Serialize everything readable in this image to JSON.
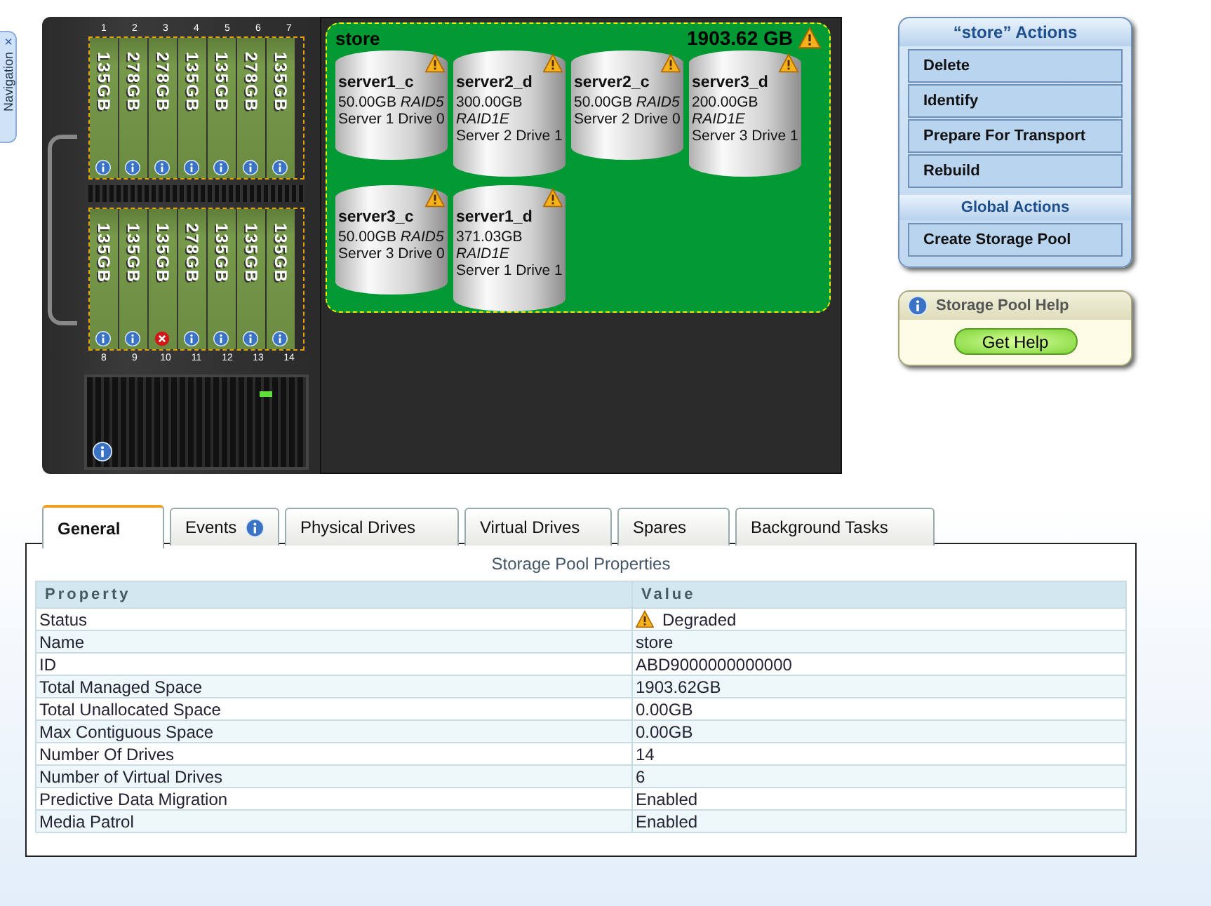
{
  "navigation_tab": {
    "label": "Navigation",
    "close": "×"
  },
  "enclosure": {
    "top_drives": [
      {
        "slot": "1",
        "label": "135GB",
        "failed": false
      },
      {
        "slot": "2",
        "label": "278GB",
        "failed": false
      },
      {
        "slot": "3",
        "label": "278GB",
        "failed": false
      },
      {
        "slot": "4",
        "label": "135GB",
        "failed": false
      },
      {
        "slot": "5",
        "label": "135GB",
        "failed": false
      },
      {
        "slot": "6",
        "label": "278GB",
        "failed": false
      },
      {
        "slot": "7",
        "label": "135GB",
        "failed": false
      }
    ],
    "bottom_drives": [
      {
        "slot": "8",
        "label": "135GB",
        "failed": false
      },
      {
        "slot": "9",
        "label": "135GB",
        "failed": false
      },
      {
        "slot": "10",
        "label": "135GB",
        "failed": true
      },
      {
        "slot": "11",
        "label": "278GB",
        "failed": false
      },
      {
        "slot": "12",
        "label": "135GB",
        "failed": false
      },
      {
        "slot": "13",
        "label": "135GB",
        "failed": false
      },
      {
        "slot": "14",
        "label": "135GB",
        "failed": false
      }
    ]
  },
  "pool": {
    "name": "store",
    "capacity": "1903.62 GB",
    "warning": true,
    "virtual_drives": [
      {
        "name": "server1_c",
        "size": "50.00GB *RAID5*",
        "location": "Server 1 Drive 0",
        "warning": true
      },
      {
        "name": "server2_d",
        "size": "300.00GB *RAID1E*",
        "location": "Server 2 Drive 1",
        "warning": true
      },
      {
        "name": "server2_c",
        "size": "50.00GB *RAID5*",
        "location": "Server 2 Drive 0",
        "warning": true
      },
      {
        "name": "server3_d",
        "size": "200.00GB *RAID1E*",
        "location": "Server 3 Drive 1",
        "warning": true
      },
      {
        "name": "server3_c",
        "size": "50.00GB *RAID5*",
        "location": "Server 3 Drive 0",
        "warning": true
      },
      {
        "name": "server1_d",
        "size": "371.03GB *RAID1E*",
        "location": "Server 1 Drive 1",
        "warning": true
      }
    ]
  },
  "actions_panel": {
    "title": "“store” Actions",
    "items": [
      "Delete",
      "Identify",
      "Prepare For Transport",
      "Rebuild"
    ],
    "global_title": "Global Actions",
    "global_items": [
      "Create Storage Pool"
    ]
  },
  "help_panel": {
    "title": "Storage Pool Help",
    "button": "Get Help"
  },
  "tabs": [
    {
      "label": "General",
      "selected": true,
      "kind": "plain"
    },
    {
      "label": "Events",
      "selected": false,
      "kind": "badged"
    },
    {
      "label": "Physical Drives",
      "selected": false,
      "kind": "plain"
    },
    {
      "label": "Virtual Drives",
      "selected": false,
      "kind": "plain"
    },
    {
      "label": "Spares",
      "selected": false,
      "kind": "plain"
    },
    {
      "label": "Background Tasks",
      "selected": false,
      "kind": "plain"
    }
  ],
  "table": {
    "title": "Storage Pool Properties",
    "columns": [
      "Property",
      "Value"
    ],
    "rows": [
      {
        "property": "Status",
        "value": "Degraded",
        "warning": true
      },
      {
        "property": "Name",
        "value": "store",
        "warning": false
      },
      {
        "property": "ID",
        "value": "ABD9000000000000",
        "warning": false
      },
      {
        "property": "Total Managed Space",
        "value": "1903.62GB",
        "warning": false
      },
      {
        "property": "Total Unallocated Space",
        "value": "0.00GB",
        "warning": false
      },
      {
        "property": "Max Contiguous Space",
        "value": "0.00GB",
        "warning": false
      },
      {
        "property": "Number Of Drives",
        "value": "14",
        "warning": false
      },
      {
        "property": "Number of Virtual Drives",
        "value": "6",
        "warning": false
      },
      {
        "property": "Predictive Data Migration",
        "value": "Enabled",
        "warning": false
      },
      {
        "property": "Media Patrol",
        "value": "Enabled",
        "warning": false
      }
    ]
  }
}
